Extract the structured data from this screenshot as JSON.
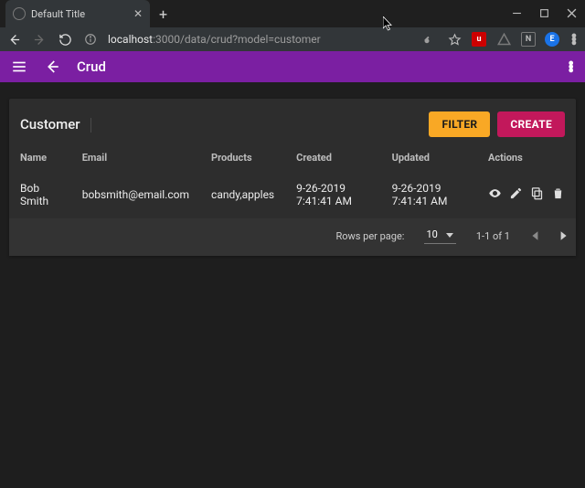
{
  "browser": {
    "tab_title": "Default Title",
    "url_host": "localhost",
    "url_path": ":3000/data/crud?model=customer"
  },
  "appbar": {
    "title": "Crud"
  },
  "card": {
    "title": "Customer",
    "filter_label": "FILTER",
    "create_label": "CREATE"
  },
  "columns": {
    "name": "Name",
    "email": "Email",
    "products": "Products",
    "created": "Created",
    "updated": "Updated",
    "actions": "Actions"
  },
  "rows": [
    {
      "name": "Bob Smith",
      "email": "bobsmith@email.com",
      "products": "candy,apples",
      "created": "9-26-2019 7:41:41 AM",
      "updated": "9-26-2019 7:41:41 AM"
    }
  ],
  "footer": {
    "rows_label": "Rows per page:",
    "rows_value": "10",
    "range": "1-1 of 1"
  }
}
